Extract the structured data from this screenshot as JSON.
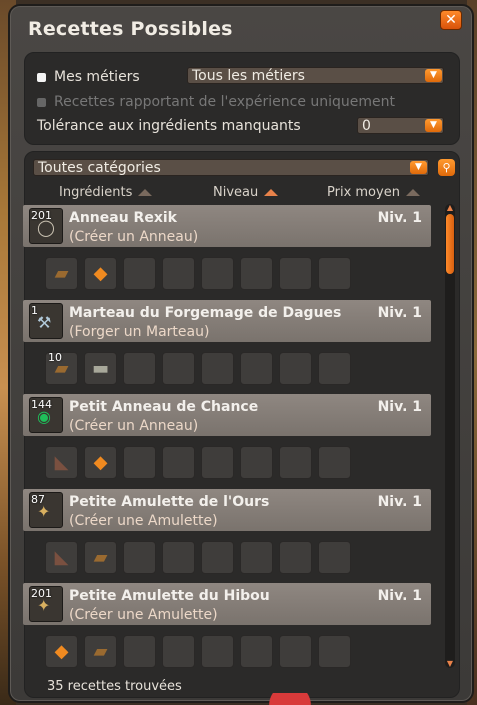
{
  "window": {
    "title": "Recettes Possibles",
    "close_label": "✕"
  },
  "filters": {
    "my_jobs_label": "Mes métiers",
    "job_select_value": "Tous les métiers",
    "xp_only_label": "Recettes rapportant de l'expérience uniquement",
    "tolerance_label": "Tolérance aux ingrédients manquants",
    "tolerance_value": "0"
  },
  "list": {
    "category_value": "Toutes catégories",
    "sort_headers": [
      "Ingrédients",
      "Niveau",
      "Prix moyen"
    ],
    "footer": "35 recettes trouvées"
  },
  "recipes": [
    {
      "qty": "201",
      "name": "Anneau Rexik",
      "sub": "(Créer un Anneau)",
      "level": "Niv. 1",
      "icon": "ring-icon",
      "ingredients": [
        {
          "icon": "wood-log-icon",
          "qty": ""
        },
        {
          "icon": "orange-gem-icon",
          "qty": ""
        }
      ]
    },
    {
      "qty": "1",
      "name": "Marteau du Forgemage de Dagues",
      "sub": "(Forger un Marteau)",
      "level": "Niv. 1",
      "icon": "hammer-icon",
      "ingredients": [
        {
          "icon": "wood-log-icon",
          "qty": "10"
        },
        {
          "icon": "stone-block-icon",
          "qty": ""
        }
      ]
    },
    {
      "qty": "144",
      "name": "Petit Anneau de Chance",
      "sub": "(Créer un Anneau)",
      "level": "Niv. 1",
      "icon": "green-ring-icon",
      "ingredients": [
        {
          "icon": "leather-icon",
          "qty": ""
        },
        {
          "icon": "orange-gem-icon",
          "qty": ""
        }
      ]
    },
    {
      "qty": "87",
      "name": "Petite Amulette de l'Ours",
      "sub": "(Créer une Amulette)",
      "level": "Niv. 1",
      "icon": "amulet-icon",
      "ingredients": [
        {
          "icon": "leather-icon",
          "qty": ""
        },
        {
          "icon": "wood-log-icon",
          "qty": ""
        }
      ]
    },
    {
      "qty": "201",
      "name": "Petite Amulette du Hibou",
      "sub": "(Créer une Amulette)",
      "level": "Niv. 1",
      "icon": "amulet-icon",
      "ingredients": [
        {
          "icon": "orange-gem-icon",
          "qty": ""
        },
        {
          "icon": "wood-log-icon",
          "qty": ""
        }
      ]
    }
  ],
  "icon_glyphs": {
    "ring-icon": "◯",
    "hammer-icon": "⚒",
    "green-ring-icon": "◉",
    "amulet-icon": "✦",
    "wood-log-icon": "▰",
    "orange-gem-icon": "◆",
    "stone-block-icon": "▬",
    "leather-icon": "◣"
  },
  "icon_colors": {
    "ring-icon": "#c8c0b0",
    "hammer-icon": "#b0c8d8",
    "green-ring-icon": "#1fbf5a",
    "amulet-icon": "#d8b060",
    "wood-log-icon": "#9a6a30",
    "orange-gem-icon": "#f08a20",
    "stone-block-icon": "#a8a89a",
    "leather-icon": "#7a5040"
  },
  "slots_per_recipe": 8
}
